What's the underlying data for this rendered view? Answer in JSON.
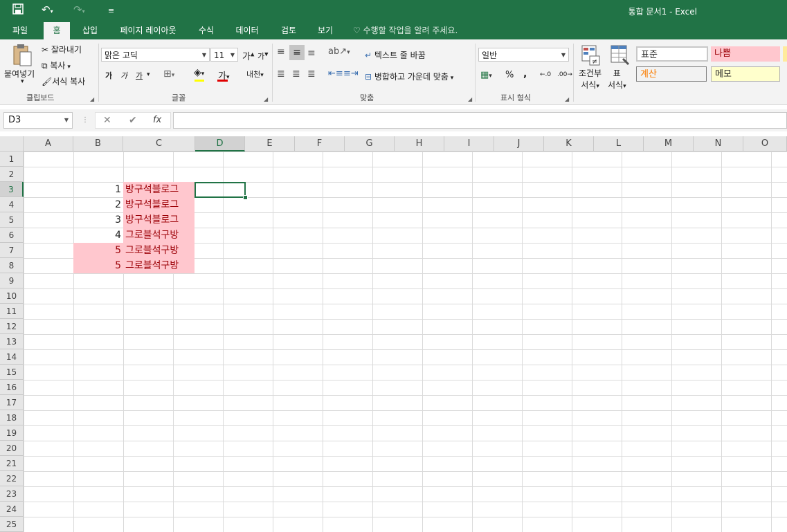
{
  "titlebar": {
    "title": "통합 문서1 - Excel",
    "qat": {
      "save_icon": "save-icon",
      "undo_icon": "undo-icon",
      "redo_icon": "redo-icon",
      "customize_icon": "customize-icon"
    }
  },
  "tabs": [
    {
      "label": "파일"
    },
    {
      "label": "홈"
    },
    {
      "label": "삽입"
    },
    {
      "label": "페이지 레이아웃"
    },
    {
      "label": "수식"
    },
    {
      "label": "데이터"
    },
    {
      "label": "검토"
    },
    {
      "label": "보기"
    }
  ],
  "active_tab": "홈",
  "tellme": "수행할 작업을 알려 주세요.",
  "ribbon": {
    "clipboard": {
      "paste": "붙여넣기",
      "cut": "잘라내기",
      "copy": "복사",
      "format_painter": "서식 복사",
      "label": "클립보드"
    },
    "font": {
      "name": "맑은 고딕",
      "size": "11",
      "bold": "가",
      "italic": "가",
      "underline": "가",
      "grow": "가",
      "shrink": "가",
      "color_glyph": "가",
      "phonetic": "내천",
      "label": "글꼴"
    },
    "alignment": {
      "wrap": "텍스트 줄 바꿈",
      "merge": "병합하고 가운데 맞춤",
      "label": "맞춤"
    },
    "number": {
      "format": "일반",
      "percent": "%",
      "comma": ",",
      "label": "표시 형식"
    },
    "styles": {
      "conditional": [
        "조건부",
        "서식"
      ],
      "table": [
        "표",
        "서식"
      ],
      "cells": [
        "표준",
        "나쁨",
        "계산",
        "메모"
      ]
    }
  },
  "formula_bar": {
    "name_box": "D3",
    "formula": ""
  },
  "colors": {
    "accent": "#217346",
    "pink_fill": "#ffc7ce",
    "pink_text": "#9c0006"
  },
  "sheet": {
    "columns": [
      "A",
      "B",
      "C",
      "D",
      "E",
      "F",
      "G",
      "H",
      "I",
      "J",
      "K",
      "L",
      "M",
      "N",
      "O"
    ],
    "rows": [
      "1",
      "2",
      "3",
      "4",
      "5",
      "6",
      "7",
      "8",
      "9",
      "10",
      "11",
      "12",
      "13",
      "14",
      "15",
      "16",
      "17",
      "18",
      "19",
      "20",
      "21",
      "22",
      "23",
      "24",
      "25"
    ],
    "selected_col": "D",
    "selected_row": "3",
    "data": [
      {
        "b": "1",
        "c": "방구석블로그"
      },
      {
        "b": "2",
        "c": "방구석블로그"
      },
      {
        "b": "3",
        "c": "방구석블로그"
      },
      {
        "b": "4",
        "c": "그로블석구방"
      },
      {
        "b": "5",
        "c": "그로블석구방"
      },
      {
        "b": "5",
        "c": "그로블석구방"
      }
    ]
  }
}
